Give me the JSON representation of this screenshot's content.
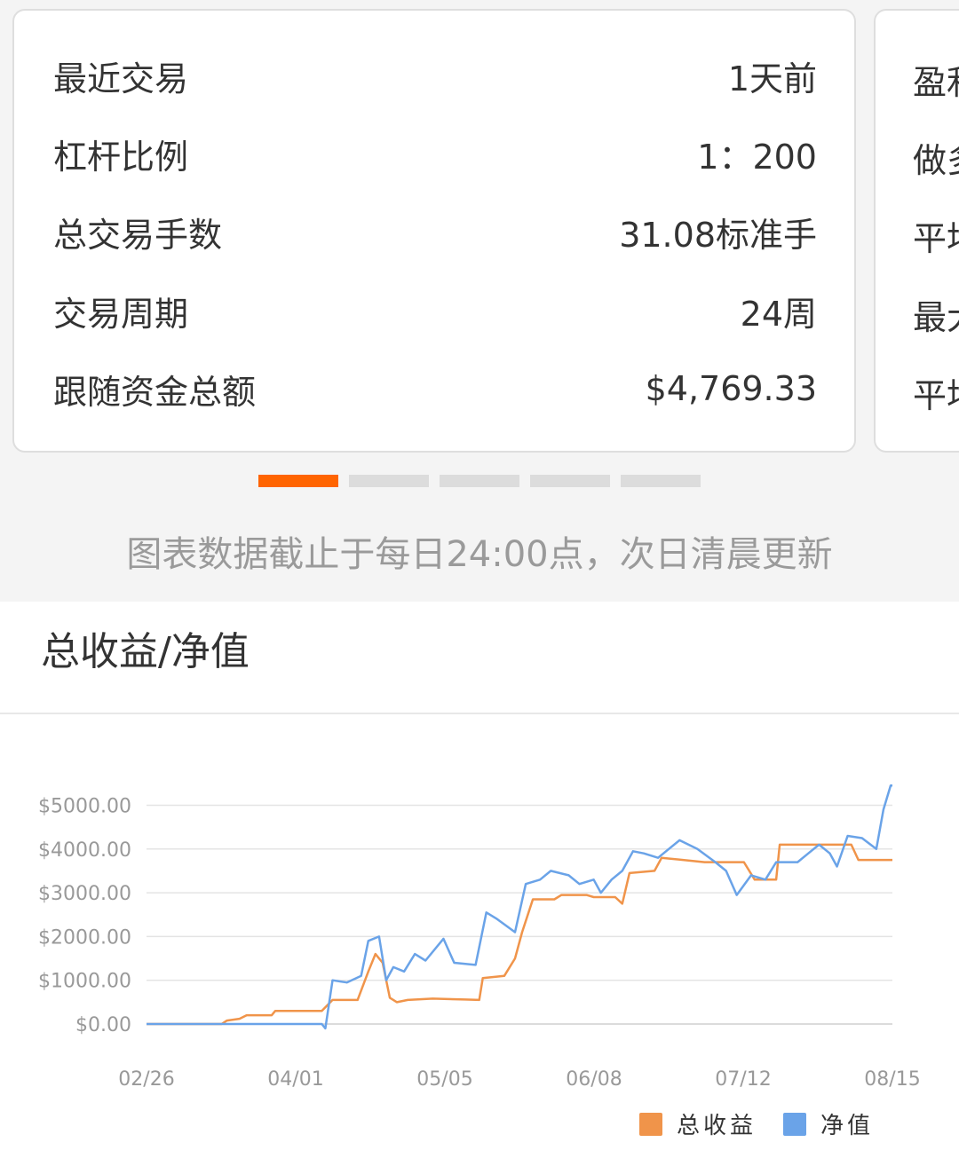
{
  "stats": [
    {
      "label": "最近交易",
      "value": "1天前"
    },
    {
      "label": "杠杆比例",
      "value": "1：200"
    },
    {
      "label": "总交易手数",
      "value": "31.08标准手"
    },
    {
      "label": "交易周期",
      "value": "24周"
    },
    {
      "label": "跟随资金总额",
      "value": "$4,769.33"
    }
  ],
  "next_card_labels": [
    "盈利",
    "做多",
    "平均",
    "最大",
    "平均"
  ],
  "pager": {
    "count": 5,
    "active": 0
  },
  "notice": "图表数据截止于每日24:00点，次日清晨更新",
  "panel": {
    "title": "总收益/净值"
  },
  "colors": {
    "accent": "#ff6400",
    "profit": "#f0944a",
    "equity": "#6aa3e8"
  },
  "chart_data": {
    "type": "line",
    "x_ticks": [
      "02/26",
      "04/01",
      "05/05",
      "06/08",
      "07/12",
      "08/15"
    ],
    "y_ticks": [
      "$0.00",
      "$1000.00",
      "$2000.00",
      "$3000.00",
      "$4000.00",
      "$5000.00"
    ],
    "ylim": [
      0,
      5500
    ],
    "grid": true,
    "legend_position": "bottom-right",
    "series": [
      {
        "name": "总收益",
        "color": "#f0944a",
        "values": [
          [
            0,
            0
          ],
          [
            20,
            0
          ],
          [
            42,
            0
          ],
          [
            45,
            80
          ],
          [
            52,
            120
          ],
          [
            56,
            200
          ],
          [
            70,
            200
          ],
          [
            72,
            300
          ],
          [
            85,
            300
          ],
          [
            98,
            300
          ],
          [
            104,
            550
          ],
          [
            118,
            550
          ],
          [
            124,
            1200
          ],
          [
            128,
            1600
          ],
          [
            132,
            1400
          ],
          [
            136,
            600
          ],
          [
            140,
            500
          ],
          [
            146,
            550
          ],
          [
            160,
            580
          ],
          [
            178,
            560
          ],
          [
            186,
            550
          ],
          [
            188,
            1050
          ],
          [
            200,
            1100
          ],
          [
            206,
            1500
          ],
          [
            210,
            2100
          ],
          [
            216,
            2850
          ],
          [
            228,
            2850
          ],
          [
            232,
            2950
          ],
          [
            246,
            2950
          ],
          [
            250,
            2900
          ],
          [
            262,
            2900
          ],
          [
            266,
            2750
          ],
          [
            270,
            3450
          ],
          [
            284,
            3500
          ],
          [
            288,
            3800
          ],
          [
            312,
            3700
          ],
          [
            334,
            3700
          ],
          [
            340,
            3300
          ],
          [
            352,
            3300
          ],
          [
            354,
            4100
          ],
          [
            372,
            4100
          ],
          [
            394,
            4100
          ],
          [
            398,
            3750
          ],
          [
            417,
            3750
          ]
        ]
      },
      {
        "name": "净值",
        "color": "#6aa3e8",
        "values": [
          [
            0,
            0
          ],
          [
            40,
            0
          ],
          [
            80,
            0
          ],
          [
            98,
            0
          ],
          [
            100,
            -100
          ],
          [
            104,
            1000
          ],
          [
            112,
            950
          ],
          [
            120,
            1100
          ],
          [
            124,
            1900
          ],
          [
            130,
            2000
          ],
          [
            134,
            1000
          ],
          [
            138,
            1300
          ],
          [
            144,
            1200
          ],
          [
            150,
            1600
          ],
          [
            156,
            1450
          ],
          [
            166,
            1950
          ],
          [
            172,
            1400
          ],
          [
            184,
            1350
          ],
          [
            190,
            2550
          ],
          [
            196,
            2400
          ],
          [
            206,
            2100
          ],
          [
            212,
            3200
          ],
          [
            220,
            3300
          ],
          [
            226,
            3500
          ],
          [
            236,
            3400
          ],
          [
            242,
            3200
          ],
          [
            250,
            3300
          ],
          [
            254,
            3000
          ],
          [
            260,
            3300
          ],
          [
            266,
            3500
          ],
          [
            272,
            3950
          ],
          [
            278,
            3900
          ],
          [
            286,
            3800
          ],
          [
            298,
            4200
          ],
          [
            308,
            4000
          ],
          [
            318,
            3700
          ],
          [
            324,
            3500
          ],
          [
            330,
            2950
          ],
          [
            338,
            3400
          ],
          [
            346,
            3300
          ],
          [
            352,
            3700
          ],
          [
            364,
            3700
          ],
          [
            370,
            3900
          ],
          [
            376,
            4100
          ],
          [
            382,
            3900
          ],
          [
            386,
            3600
          ],
          [
            392,
            4300
          ],
          [
            400,
            4250
          ],
          [
            408,
            4000
          ],
          [
            412,
            4900
          ],
          [
            416,
            5450
          ],
          [
            417,
            5450
          ]
        ]
      }
    ]
  }
}
